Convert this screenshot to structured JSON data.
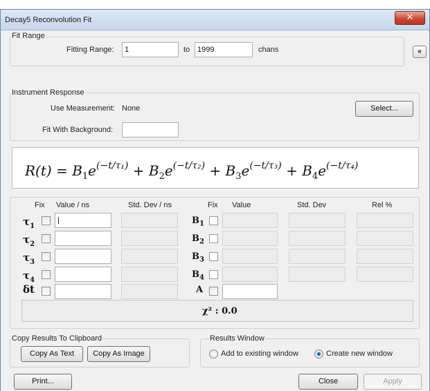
{
  "window": {
    "title": "Decay5  Reconvolution Fit",
    "close_glyph": "✕"
  },
  "fit_range": {
    "group_label": "Fit Range",
    "fitting_range_label": "Fitting Range:",
    "from_value": "1",
    "to_label": "to",
    "to_value": "1999",
    "units": "chans",
    "collapse_glyph": "«"
  },
  "instrument": {
    "group_label": "Instrument Response",
    "use_measurement_label": "Use Measurement:",
    "use_measurement_value": "None",
    "select_button": "Select...",
    "background_label": "Fit With Background:",
    "background_value": ""
  },
  "formula": {
    "text": "R(t) = B₁e^(−t/τ₁) + B₂e^(−t/τ₂) + B₃e^(−t/τ₃) + B₄e^(−t/τ₄)",
    "lhs": "R(t) = ",
    "terms": [
      {
        "B": "B",
        "i": "1",
        "plus": " + "
      },
      {
        "B": "B",
        "i": "2",
        "plus": " + "
      },
      {
        "B": "B",
        "i": "3",
        "plus": " + "
      },
      {
        "B": "B",
        "i": "4",
        "plus": ""
      }
    ]
  },
  "params": {
    "headers": {
      "fix1": "Fix",
      "value_ns": "Value / ns",
      "std_dev_ns": "Std. Dev / ns",
      "fix2": "Fix",
      "value": "Value",
      "std_dev": "Std. Dev",
      "rel": "Rel %"
    },
    "tau_rows": [
      {
        "sym": "τ",
        "sub": "1",
        "value": "|"
      },
      {
        "sym": "τ",
        "sub": "2",
        "value": ""
      },
      {
        "sym": "τ",
        "sub": "3",
        "value": ""
      },
      {
        "sym": "τ",
        "sub": "4",
        "value": ""
      },
      {
        "sym": "δt",
        "sub": "",
        "value": ""
      }
    ],
    "b_rows": [
      {
        "sym": "B",
        "sub": "1"
      },
      {
        "sym": "B",
        "sub": "2"
      },
      {
        "sym": "B",
        "sub": "3"
      },
      {
        "sym": "B",
        "sub": "4"
      },
      {
        "sym": "A",
        "sub": ""
      }
    ],
    "chi_label": "χ² : 0.0"
  },
  "clipboard": {
    "group_label": "Copy Results To Clipboard",
    "copy_text": "Copy As Text",
    "copy_image": "Copy As Image"
  },
  "results": {
    "group_label": "Results Window",
    "add_existing": "Add to existing window",
    "create_new": "Create new window",
    "selected": "create_new"
  },
  "footer": {
    "print": "Print...",
    "close": "Close",
    "apply": "Apply"
  }
}
